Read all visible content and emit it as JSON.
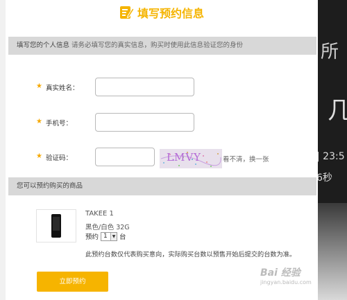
{
  "dialog": {
    "title": "填写预约信息",
    "personal_section": {
      "heading": "填写您的个人信息",
      "note": "请务必填写您的真实信息，购买时使用此信息验证您的身份"
    },
    "fields": {
      "name_label": "真实姓名：",
      "phone_label": "手机号：",
      "code_label": "验证码："
    },
    "captcha": {
      "text": "LMVY",
      "refresh_link": "看不清，换一张"
    },
    "products_section": {
      "heading": "您可以预约购买的商品"
    },
    "product": {
      "name": "TAKEE 1",
      "spec": "黑色/白色 32G",
      "qty_prefix": "预约",
      "qty_value": "1",
      "qty_unit": "台",
      "disclaimer": "此预约台数仅代表购买意向，实际购买台数以预售开始后提交的台数为准。"
    },
    "submit_label": "立即预约"
  },
  "background": {
    "snippets": [
      "所",
      "几",
      "| 23:5",
      "6秒"
    ]
  },
  "watermark": {
    "line1": "Bai 经验",
    "line2": "jingyan.baidu.com"
  },
  "colors": {
    "accent": "#f5b400",
    "section_bar": "#d8d8d8",
    "dark_panel": "#1d1d1d"
  }
}
